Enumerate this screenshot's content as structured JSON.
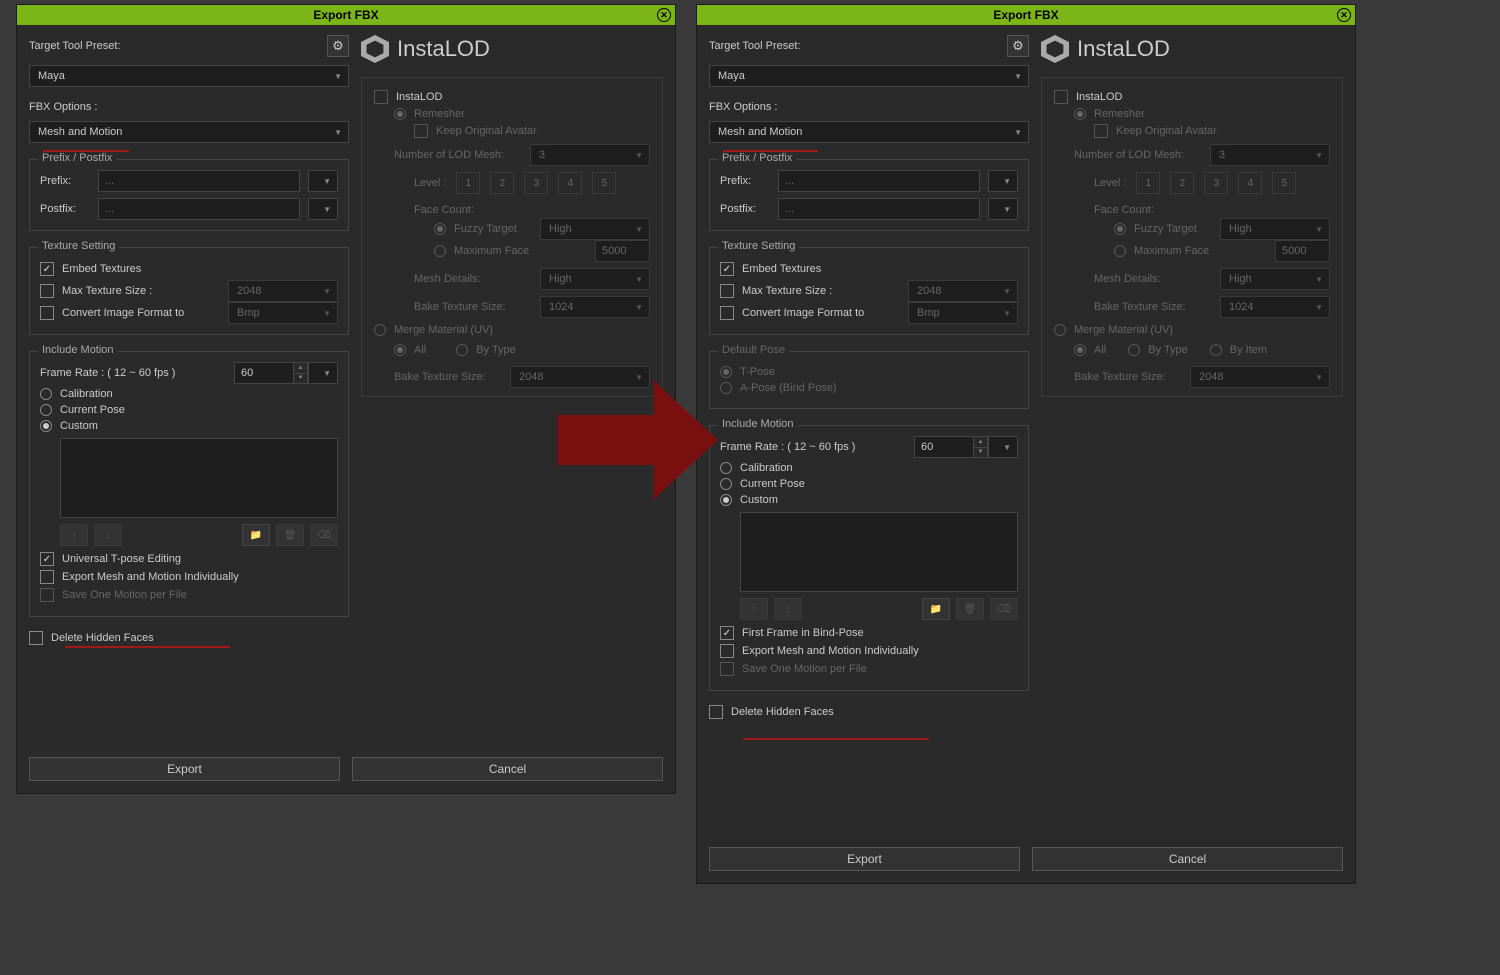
{
  "window_title": "Export FBX",
  "target_label": "Target Tool Preset:",
  "target_value": "Maya",
  "fbx_options_label": "FBX Options :",
  "fbx_options_value": "Mesh and Motion",
  "prefix_postfix": {
    "title": "Prefix / Postfix",
    "prefix_label": "Prefix:",
    "postfix_label": "Postfix:",
    "placeholder": "..."
  },
  "texture": {
    "title": "Texture Setting",
    "embed": "Embed Textures",
    "maxsize": "Max Texture Size :",
    "maxsize_val": "2048",
    "convert": "Convert Image Format to",
    "convert_val": "Bmp"
  },
  "default_pose": {
    "title": "Default Pose",
    "tpose": "T-Pose",
    "apose": "A-Pose (Bind Pose)"
  },
  "motion": {
    "title": "Include Motion",
    "frame_rate_label": "Frame Rate : ( 12 ~ 60 fps )",
    "frame_rate_val": "60",
    "calibration": "Calibration",
    "current_pose": "Current Pose",
    "custom": "Custom",
    "universal": "Universal T-pose Editing",
    "first_frame": "First Frame in Bind-Pose",
    "export_ind": "Export Mesh and Motion Individually",
    "save_one": "Save One Motion per File"
  },
  "delete_hidden": "Delete Hidden Faces",
  "export_btn": "Export",
  "cancel_btn": "Cancel",
  "instalod": {
    "brand": "InstaLOD",
    "instalod": "InstaLOD",
    "remesher": "Remesher",
    "keep_avatar": "Keep Original Avatar",
    "num_lod": "Number of LOD Mesh:",
    "num_lod_val": "3",
    "level": "Level :",
    "levels": [
      "1",
      "2",
      "3",
      "4",
      "5"
    ],
    "face_count": "Face Count:",
    "fuzzy": "Fuzzy Target",
    "fuzzy_val": "High",
    "max_face": "Maximum Face",
    "max_face_val": "5000",
    "mesh_details": "Mesh Details:",
    "mesh_details_val": "High",
    "bake_size": "Bake Texture Size:",
    "bake_size_val": "1024",
    "merge": "Merge Material (UV)",
    "all": "All",
    "by_type": "By Type",
    "by_item": "By Item",
    "merge_bake": "Bake Texture Size:",
    "merge_bake_val": "2048"
  }
}
